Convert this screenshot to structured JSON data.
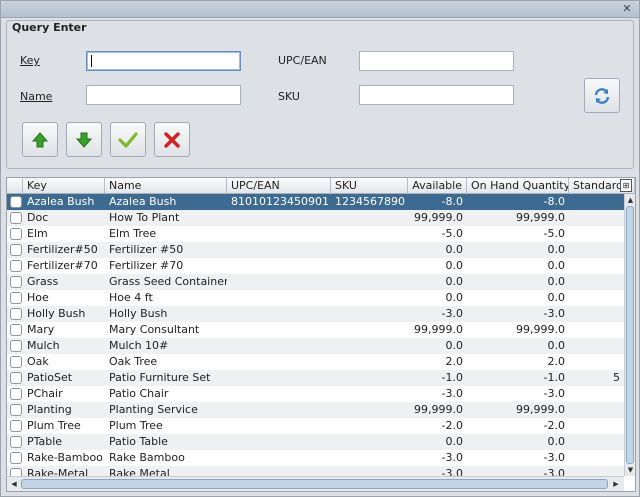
{
  "panel": {
    "title": "Query Enter",
    "key_label": "Key",
    "name_label": "Name",
    "upc_label": "UPC/EAN",
    "sku_label": "SKU",
    "key_value": "",
    "name_value": "",
    "upc_value": "",
    "sku_value": ""
  },
  "toolbar": {
    "buttons": [
      "up-arrow-icon",
      "down-arrow-icon",
      "ok-check-icon",
      "cancel-x-icon"
    ],
    "refresh": "refresh-icon"
  },
  "colors": {
    "selection": "#3d6a90",
    "green": "#3aa02a",
    "red": "#d62020",
    "refresh_blue": "#3a7fc4"
  },
  "table": {
    "columns": [
      "Key",
      "Name",
      "UPC/EAN",
      "SKU",
      "Available",
      "On Hand Quantity",
      "Standard"
    ],
    "rows": [
      {
        "key": "Azalea Bush",
        "name": "Azalea Bush",
        "upc": "81010123450901",
        "sku": "1234567890",
        "available": "-8.0",
        "onhand": "-8.0",
        "standard": ""
      },
      {
        "key": "Doc",
        "name": "How To Plant",
        "upc": "",
        "sku": "",
        "available": "99,999.0",
        "onhand": "99,999.0",
        "standard": ""
      },
      {
        "key": "Elm",
        "name": "Elm Tree",
        "upc": "",
        "sku": "",
        "available": "-5.0",
        "onhand": "-5.0",
        "standard": ""
      },
      {
        "key": "Fertilizer#50",
        "name": "Fertilizer #50",
        "upc": "",
        "sku": "",
        "available": "0.0",
        "onhand": "0.0",
        "standard": ""
      },
      {
        "key": "Fertilizer#70",
        "name": "Fertilizer #70",
        "upc": "",
        "sku": "",
        "available": "0.0",
        "onhand": "0.0",
        "standard": ""
      },
      {
        "key": "Grass",
        "name": "Grass Seed Container",
        "upc": "",
        "sku": "",
        "available": "0.0",
        "onhand": "0.0",
        "standard": ""
      },
      {
        "key": "Hoe",
        "name": "Hoe 4 ft",
        "upc": "",
        "sku": "",
        "available": "0.0",
        "onhand": "0.0",
        "standard": ""
      },
      {
        "key": "Holly Bush",
        "name": "Holly Bush",
        "upc": "",
        "sku": "",
        "available": "-3.0",
        "onhand": "-3.0",
        "standard": ""
      },
      {
        "key": "Mary",
        "name": "Mary Consultant",
        "upc": "",
        "sku": "",
        "available": "99,999.0",
        "onhand": "99,999.0",
        "standard": ""
      },
      {
        "key": "Mulch",
        "name": "Mulch 10#",
        "upc": "",
        "sku": "",
        "available": "0.0",
        "onhand": "0.0",
        "standard": ""
      },
      {
        "key": "Oak",
        "name": "Oak Tree",
        "upc": "",
        "sku": "",
        "available": "2.0",
        "onhand": "2.0",
        "standard": ""
      },
      {
        "key": "PatioSet",
        "name": "Patio Furniture Set",
        "upc": "",
        "sku": "",
        "available": "-1.0",
        "onhand": "-1.0",
        "standard": "5"
      },
      {
        "key": "PChair",
        "name": "Patio Chair",
        "upc": "",
        "sku": "",
        "available": "-3.0",
        "onhand": "-3.0",
        "standard": ""
      },
      {
        "key": "Planting",
        "name": "Planting Service",
        "upc": "",
        "sku": "",
        "available": "99,999.0",
        "onhand": "99,999.0",
        "standard": ""
      },
      {
        "key": "Plum Tree",
        "name": "Plum Tree",
        "upc": "",
        "sku": "",
        "available": "-2.0",
        "onhand": "-2.0",
        "standard": ""
      },
      {
        "key": "PTable",
        "name": "Patio Table",
        "upc": "",
        "sku": "",
        "available": "0.0",
        "onhand": "0.0",
        "standard": ""
      },
      {
        "key": "Rake-Bamboo",
        "name": "Rake Bamboo",
        "upc": "",
        "sku": "",
        "available": "-3.0",
        "onhand": "-3.0",
        "standard": ""
      },
      {
        "key": "Rake-Metal",
        "name": "Rake Metal",
        "upc": "",
        "sku": "",
        "available": "-3.0",
        "onhand": "-3.0",
        "standard": ""
      }
    ]
  }
}
